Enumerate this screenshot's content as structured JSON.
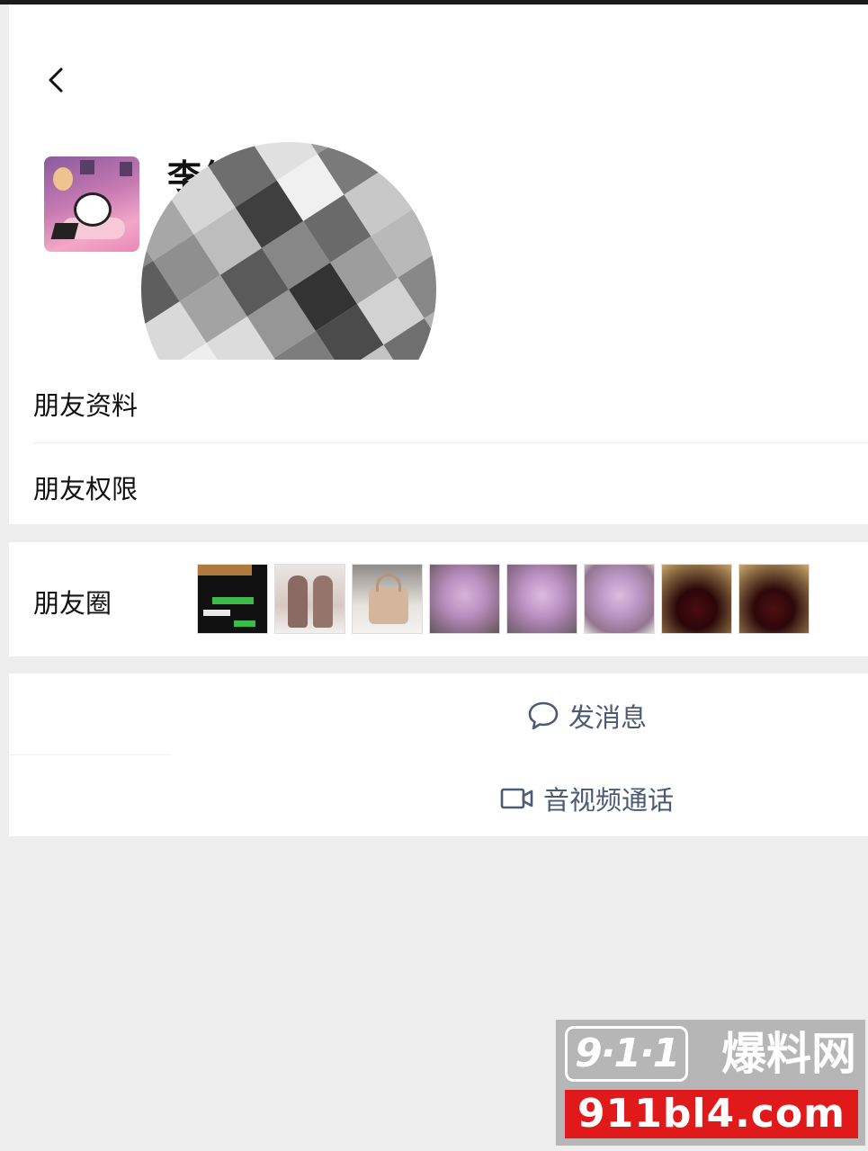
{
  "profile": {
    "nickname": "李作",
    "avatar_alt": "avatar"
  },
  "menu": {
    "profile_label": "朋友资料",
    "permissions_label": "朋友权限",
    "moments_label": "朋友圈"
  },
  "moments_thumbnails": [
    {
      "name": "chat-screenshot"
    },
    {
      "name": "shoes-photo"
    },
    {
      "name": "handbag-photo"
    },
    {
      "name": "pink-flowers-photo-1"
    },
    {
      "name": "pink-flowers-photo-2"
    },
    {
      "name": "pink-flowers-photo-3"
    },
    {
      "name": "red-roses-photo-1"
    },
    {
      "name": "red-roses-photo-2"
    }
  ],
  "actions": {
    "message_label": "发消息",
    "call_label": "音视频通话",
    "message_icon": "chat-bubble-icon",
    "call_icon": "video-camera-icon"
  },
  "watermark": {
    "logo": "9·1·1",
    "name": "爆料网",
    "url": "911bl4.com"
  },
  "colors": {
    "action_text": "#4c5a73",
    "page_bg": "#ededed",
    "card_bg": "#ffffff",
    "watermark_red": "#e0191b"
  }
}
